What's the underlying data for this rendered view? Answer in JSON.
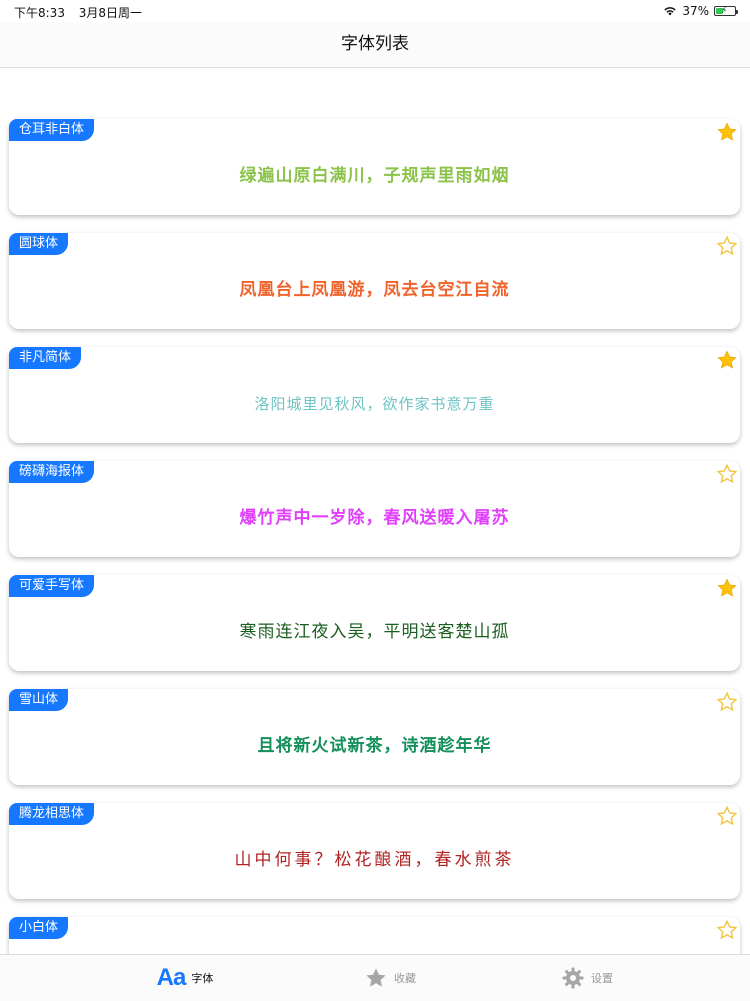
{
  "status": {
    "time": "下午8:33",
    "date": "3月8日周一",
    "battery": "37%"
  },
  "nav": {
    "title": "字体列表"
  },
  "fonts": [
    {
      "name": "仓耳非白体",
      "sample": "绿遍山原白满川，子规声里雨如烟",
      "color": "#8bc34a",
      "starred": true
    },
    {
      "name": "圆球体",
      "sample": "凤凰台上凤凰游，凤去台空江自流",
      "color": "#f0622a",
      "starred": false
    },
    {
      "name": "非凡简体",
      "sample": "洛阳城里见秋风，欲作家书意万重",
      "color": "#6fc4c4",
      "starred": true
    },
    {
      "name": "磅礴海报体",
      "sample": "爆竹声中一岁除，春风送暖入屠苏",
      "color": "#e040fb",
      "starred": false
    },
    {
      "name": "可爱手写体",
      "sample": "寒雨连江夜入吴，平明送客楚山孤",
      "color": "#1b5e20",
      "starred": true
    },
    {
      "name": "雪山体",
      "sample": "且将新火试新茶，诗酒趁年华",
      "color": "#138f5a",
      "starred": false
    },
    {
      "name": "腾龙相思体",
      "sample": "山中何事？松花酿酒，春水煎茶",
      "color": "#b22222",
      "starred": false
    },
    {
      "name": "小白体",
      "sample": "",
      "color": "#333333",
      "starred": false
    }
  ],
  "tabs": [
    {
      "label": "字体",
      "icon": "font-aa-icon",
      "active": true
    },
    {
      "label": "收藏",
      "icon": "star-icon",
      "active": false
    },
    {
      "label": "设置",
      "icon": "gear-icon",
      "active": false
    }
  ],
  "colors": {
    "accent": "#1677ff",
    "star_filled": "#ffc107",
    "star_empty": "#f2c744"
  }
}
